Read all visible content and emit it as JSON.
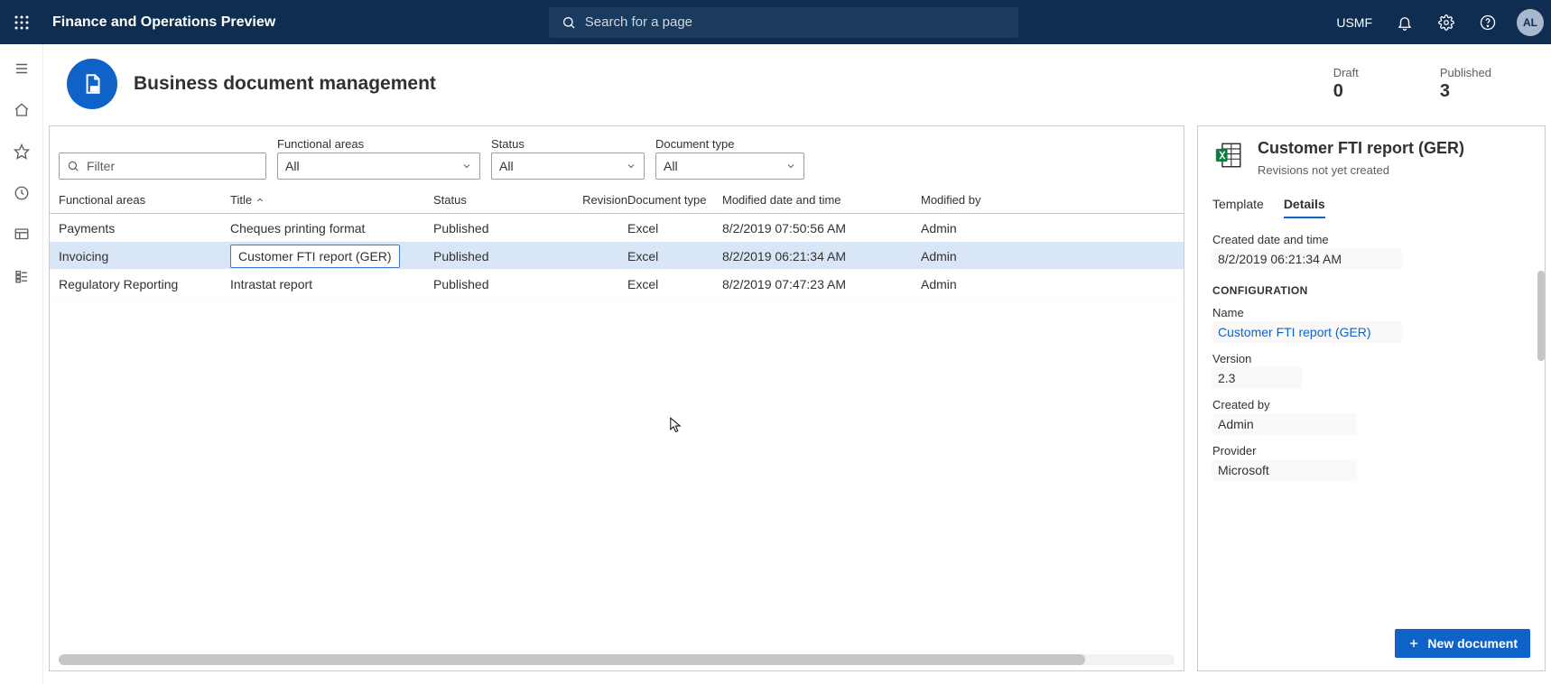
{
  "topbar": {
    "title": "Finance and Operations Preview",
    "search_placeholder": "Search for a page",
    "company": "USMF",
    "avatar": "AL"
  },
  "page": {
    "title": "Business document management",
    "stats": {
      "draft_label": "Draft",
      "draft_value": "0",
      "published_label": "Published",
      "published_value": "3"
    }
  },
  "filters": {
    "filter_placeholder": "Filter",
    "functional_areas_label": "Functional areas",
    "functional_areas_value": "All",
    "status_label": "Status",
    "status_value": "All",
    "doc_type_label": "Document type",
    "doc_type_value": "All"
  },
  "columns": {
    "functional_areas": "Functional areas",
    "title": "Title",
    "status": "Status",
    "revision": "Revision",
    "doc_type": "Document type",
    "modified_dt": "Modified date and time",
    "modified_by": "Modified by"
  },
  "rows": [
    {
      "fa": "Payments",
      "title": "Cheques printing format",
      "status": "Published",
      "revision": "",
      "doc_type": "Excel",
      "mdt": "8/2/2019 07:50:56 AM",
      "mby": "Admin"
    },
    {
      "fa": "Invoicing",
      "title": "Customer FTI report (GER)",
      "status": "Published",
      "revision": "",
      "doc_type": "Excel",
      "mdt": "8/2/2019 06:21:34 AM",
      "mby": "Admin"
    },
    {
      "fa": "Regulatory Reporting",
      "title": "Intrastat report",
      "status": "Published",
      "revision": "",
      "doc_type": "Excel",
      "mdt": "8/2/2019 07:47:23 AM",
      "mby": "Admin"
    }
  ],
  "selected_row_index": 1,
  "details": {
    "title": "Customer FTI report (GER)",
    "subtitle": "Revisions not yet created",
    "tabs": {
      "template": "Template",
      "details": "Details"
    },
    "created_label": "Created date and time",
    "created_value": "8/2/2019 06:21:34 AM",
    "config_section": "CONFIGURATION",
    "name_label": "Name",
    "name_value": "Customer FTI report (GER)",
    "version_label": "Version",
    "version_value": "2.3",
    "created_by_label": "Created by",
    "created_by_value": "Admin",
    "provider_label": "Provider",
    "provider_value": "Microsoft",
    "new_document": "New document"
  }
}
